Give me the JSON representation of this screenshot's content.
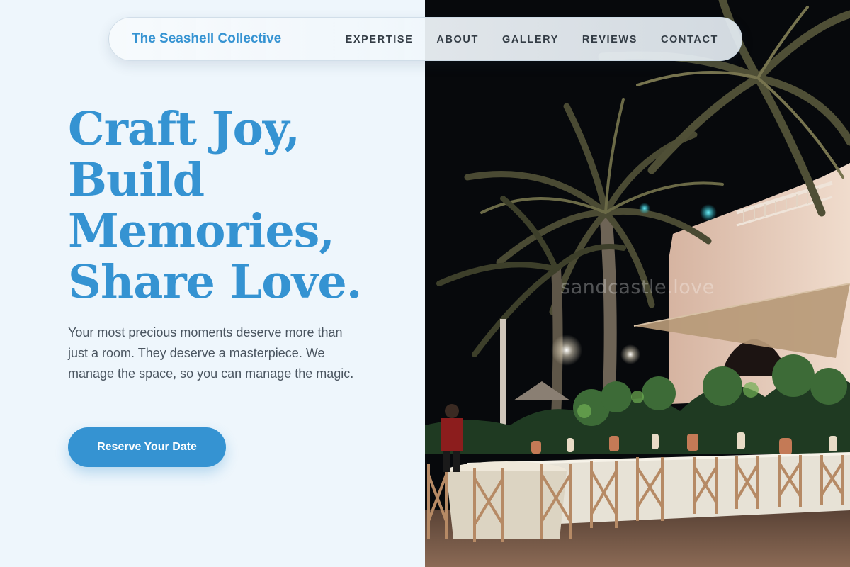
{
  "brand": {
    "name": "The Seashell Collective"
  },
  "nav": {
    "items": [
      {
        "label": "EXPERTISE"
      },
      {
        "label": "ABOUT"
      },
      {
        "label": "GALLERY"
      },
      {
        "label": "REVIEWS"
      },
      {
        "label": "CONTACT"
      }
    ]
  },
  "hero": {
    "headline_lines": [
      "Craft Joy,",
      "Build",
      "Memories,",
      "Share Love."
    ],
    "intro": "Your most precious moments deserve more than just a room. They deserve a masterpiece. We manage the space, so you can manage the magic.",
    "cta_label": "Reserve Your Date",
    "image_watermark": "sandcastle.love"
  },
  "colors": {
    "accent": "#3593d2",
    "page_background": "#eef6fc",
    "nav_text": "#333c45",
    "body_text": "#4a5560"
  }
}
